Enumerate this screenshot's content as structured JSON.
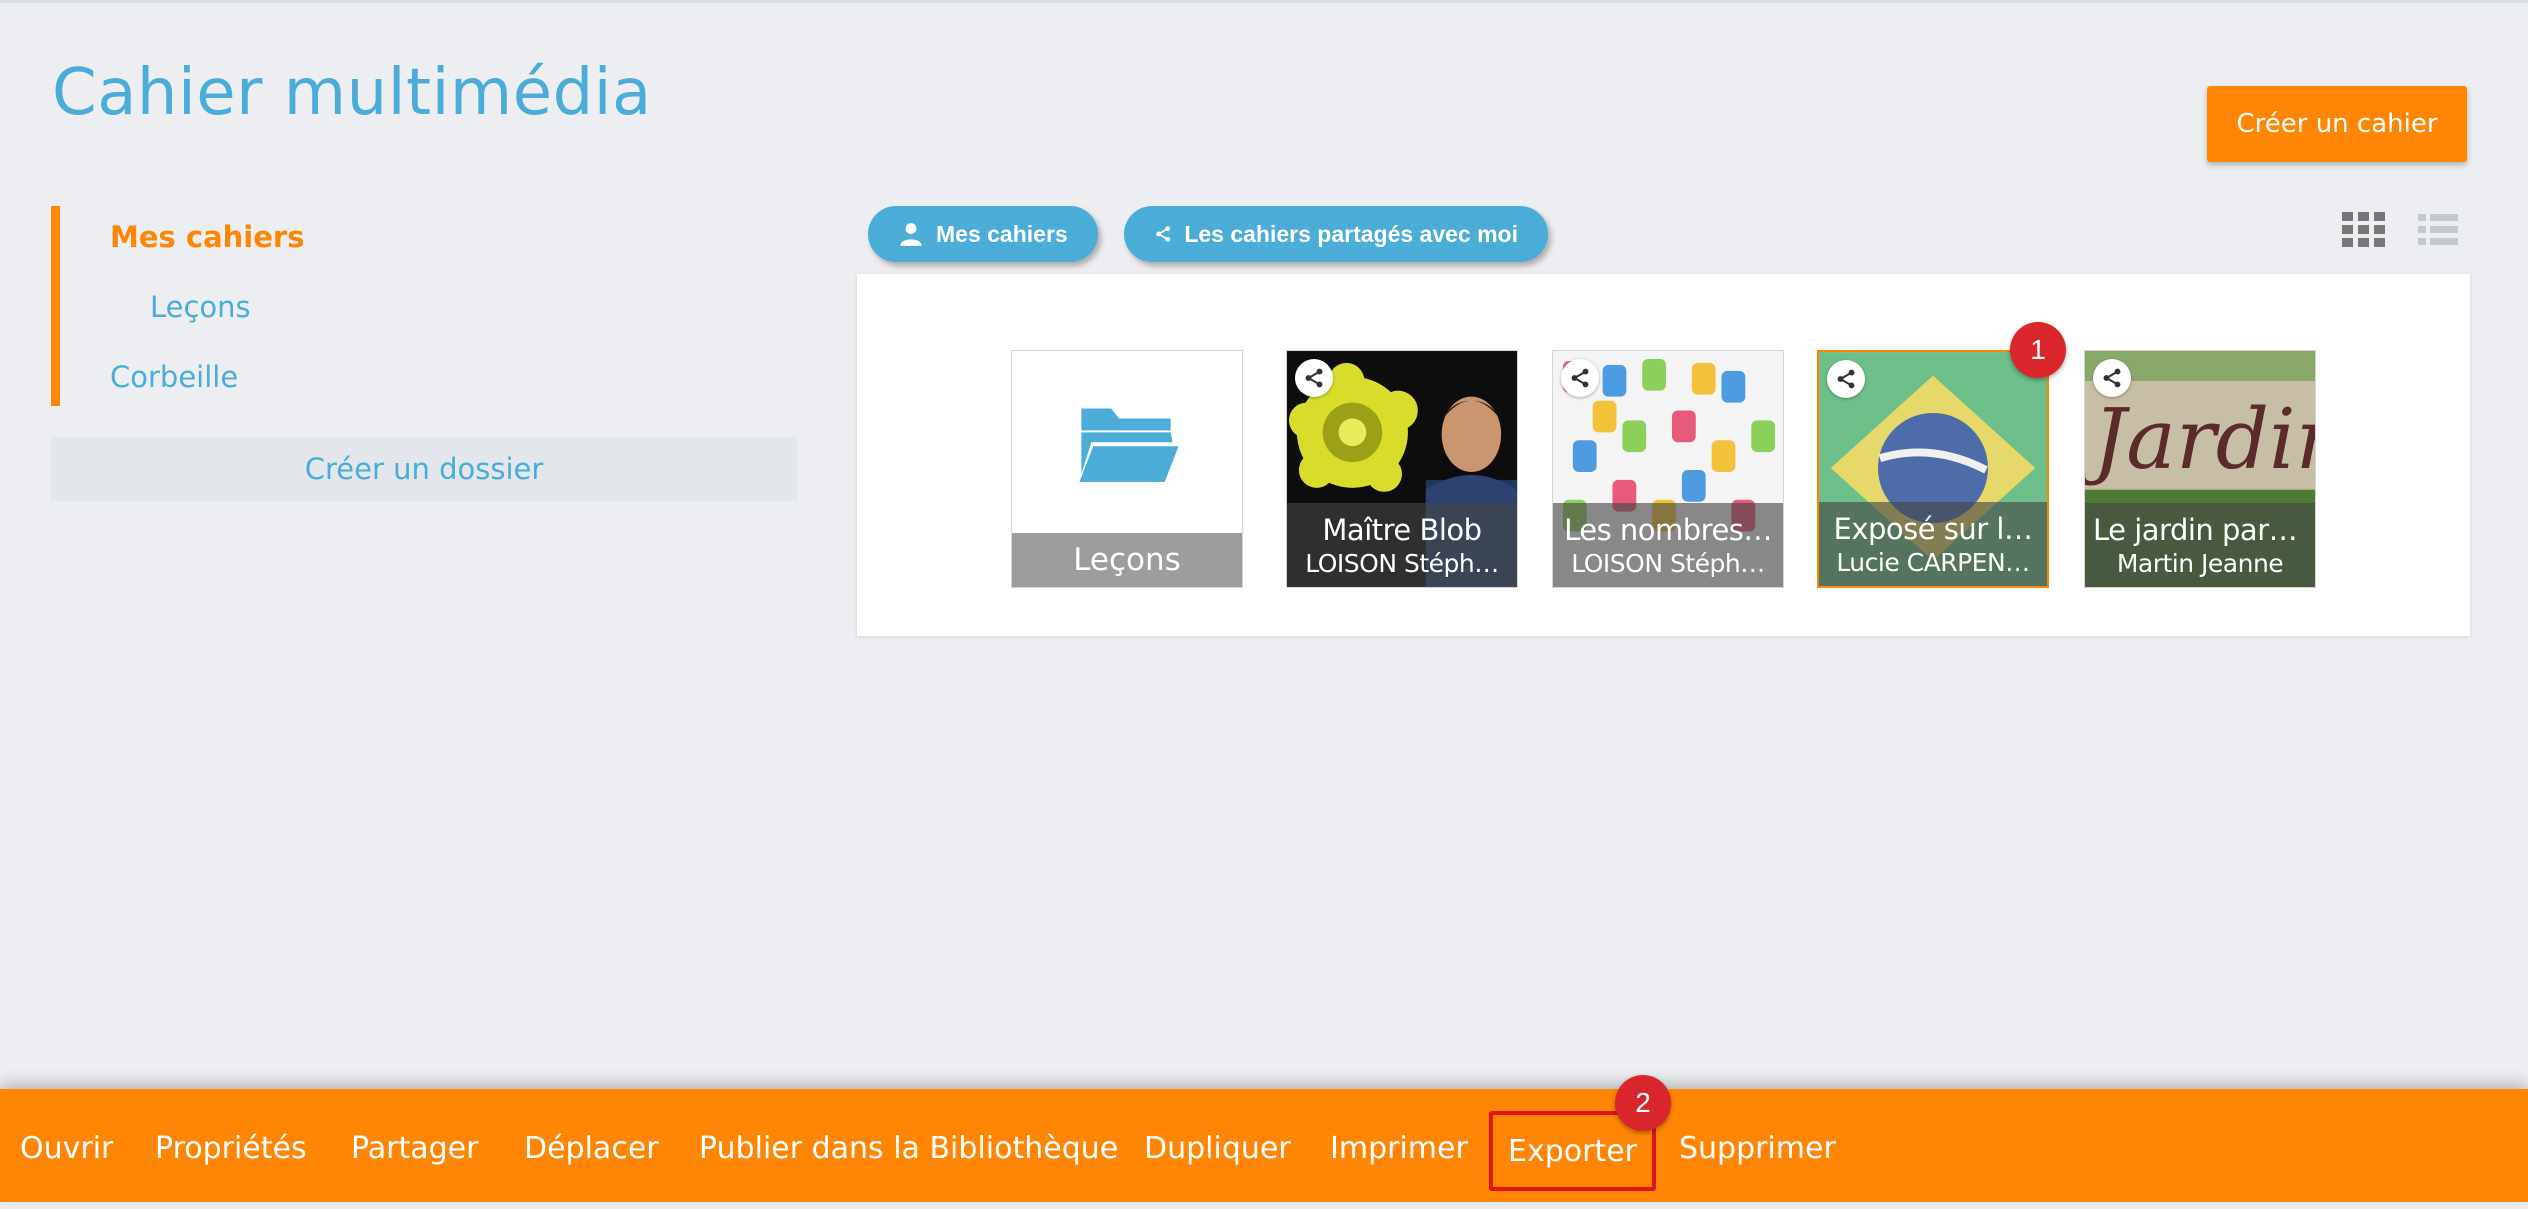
{
  "page": {
    "title": "Cahier multimédia"
  },
  "header": {
    "create_notebook_label": "Créer un cahier"
  },
  "sidebar": {
    "items": [
      {
        "label": "Mes cahiers",
        "active": true
      },
      {
        "label": "Leçons",
        "active": false
      },
      {
        "label": "Corbeille",
        "active": false
      }
    ],
    "create_folder_label": "Créer un dossier"
  },
  "filters": [
    {
      "label": "Mes cahiers",
      "icon": "user-icon"
    },
    {
      "label": "Les cahiers partagés avec moi",
      "icon": "share-icon"
    }
  ],
  "view_modes": [
    "grid-view-icon",
    "list-view-icon"
  ],
  "cards": [
    {
      "type": "folder",
      "title": "Leçons",
      "icon": "folder-open-icon"
    },
    {
      "type": "notebook",
      "title": "Maître Blob",
      "owner": "LOISON Stéph…",
      "shared": true,
      "selected": false
    },
    {
      "type": "notebook",
      "title": "Les nombres…",
      "owner": "LOISON Stéph…",
      "shared": true,
      "selected": false
    },
    {
      "type": "notebook",
      "title": "Exposé sur l…",
      "owner": "Lucie CARPEN…",
      "shared": true,
      "selected": true
    },
    {
      "type": "notebook",
      "title": "Le jardin part…",
      "owner": "Martin Jeanne",
      "shared": true,
      "selected": false
    }
  ],
  "thumb_text": {
    "garden_sign": "Jardin"
  },
  "step_badges": [
    "1",
    "2"
  ],
  "action_bar": {
    "actions": [
      "Ouvrir",
      "Propriétés",
      "Partager",
      "Déplacer",
      "Publier dans la Bibliothèque",
      "Dupliquer",
      "Imprimer",
      "Exporter",
      "Supprimer"
    ],
    "highlighted": "Exporter"
  },
  "colors": {
    "accent": "#ff8504",
    "primary": "#4aacd7",
    "badge": "#d9262c",
    "background": "#eceef1"
  }
}
